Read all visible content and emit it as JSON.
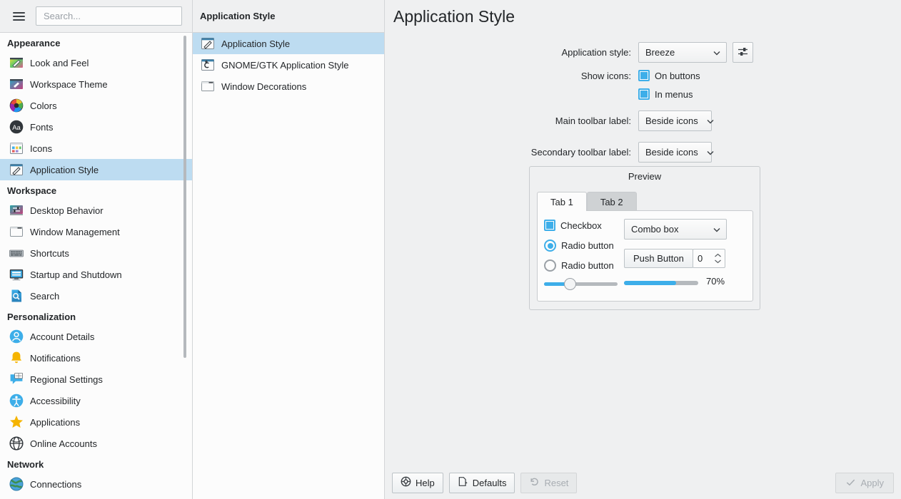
{
  "search": {
    "placeholder": "Search...",
    "value": ""
  },
  "sidebar": {
    "groups": [
      {
        "title": "Appearance",
        "items": [
          {
            "label": "Look and Feel",
            "icon": "look-and-feel-icon",
            "selected": false
          },
          {
            "label": "Workspace Theme",
            "icon": "workspace-theme-icon",
            "selected": false
          },
          {
            "label": "Colors",
            "icon": "colors-icon",
            "selected": false
          },
          {
            "label": "Fonts",
            "icon": "fonts-icon",
            "selected": false
          },
          {
            "label": "Icons",
            "icon": "icons-icon",
            "selected": false
          },
          {
            "label": "Application Style",
            "icon": "application-style-icon",
            "selected": true
          }
        ]
      },
      {
        "title": "Workspace",
        "items": [
          {
            "label": "Desktop Behavior",
            "icon": "desktop-behavior-icon",
            "selected": false
          },
          {
            "label": "Window Management",
            "icon": "window-management-icon",
            "selected": false
          },
          {
            "label": "Shortcuts",
            "icon": "shortcuts-icon",
            "selected": false
          },
          {
            "label": "Startup and Shutdown",
            "icon": "startup-shutdown-icon",
            "selected": false
          },
          {
            "label": "Search",
            "icon": "search-module-icon",
            "selected": false
          }
        ]
      },
      {
        "title": "Personalization",
        "items": [
          {
            "label": "Account Details",
            "icon": "account-details-icon",
            "selected": false
          },
          {
            "label": "Notifications",
            "icon": "notifications-icon",
            "selected": false
          },
          {
            "label": "Regional Settings",
            "icon": "regional-settings-icon",
            "selected": false
          },
          {
            "label": "Accessibility",
            "icon": "accessibility-icon",
            "selected": false
          },
          {
            "label": "Applications",
            "icon": "applications-icon",
            "selected": false
          },
          {
            "label": "Online Accounts",
            "icon": "online-accounts-icon",
            "selected": false
          }
        ]
      },
      {
        "title": "Network",
        "items": [
          {
            "label": "Connections",
            "icon": "connections-icon",
            "selected": false
          }
        ]
      }
    ]
  },
  "midpanel": {
    "header": "Application Style",
    "items": [
      {
        "label": "Application Style",
        "icon": "application-style-icon",
        "selected": true
      },
      {
        "label": "GNOME/GTK Application Style",
        "icon": "gtk-style-icon",
        "selected": false
      },
      {
        "label": "Window Decorations",
        "icon": "window-decorations-icon",
        "selected": false
      }
    ]
  },
  "main": {
    "title": "Application Style",
    "fields": {
      "application_style": {
        "label": "Application style:",
        "value": "Breeze",
        "configure_icon": "configure-sliders-icon"
      },
      "show_icons": {
        "label": "Show icons:",
        "on_buttons": {
          "label": "On buttons",
          "checked": true
        },
        "in_menus": {
          "label": "In menus",
          "checked": true
        }
      },
      "main_toolbar_label": {
        "label": "Main toolbar label:",
        "value": "Beside icons"
      },
      "secondary_toolbar_label": {
        "label": "Secondary toolbar label:",
        "value": "Beside icons"
      }
    }
  },
  "preview": {
    "title": "Preview",
    "tabs": [
      {
        "label": "Tab 1",
        "active": true
      },
      {
        "label": "Tab 2",
        "active": false
      }
    ],
    "checkbox": {
      "label": "Checkbox",
      "checked": true
    },
    "radio_1": {
      "label": "Radio button",
      "selected": true
    },
    "radio_2": {
      "label": "Radio button",
      "selected": false
    },
    "combo": {
      "value": "Combo box"
    },
    "push_button": {
      "label": "Push Button"
    },
    "spinbox": {
      "value": "0"
    },
    "slider": {
      "percent": 35
    },
    "progress": {
      "percent": 70,
      "label": "70%"
    }
  },
  "footer": {
    "help": {
      "label": "Help",
      "icon": "help-lifering-icon",
      "enabled": true
    },
    "defaults": {
      "label": "Defaults",
      "icon": "defaults-document-icon",
      "enabled": true
    },
    "reset": {
      "label": "Reset",
      "icon": "reset-undo-icon",
      "enabled": false
    },
    "apply": {
      "label": "Apply",
      "icon": "apply-check-icon",
      "enabled": false
    }
  },
  "colors": {
    "accent": "#3daee9",
    "selection": "#bddcf1",
    "window_bg": "#eff0f1",
    "view_bg": "#fcfcfc",
    "text": "#232629",
    "disabled_text": "#a8adb2",
    "border": "#bdc3c7"
  }
}
